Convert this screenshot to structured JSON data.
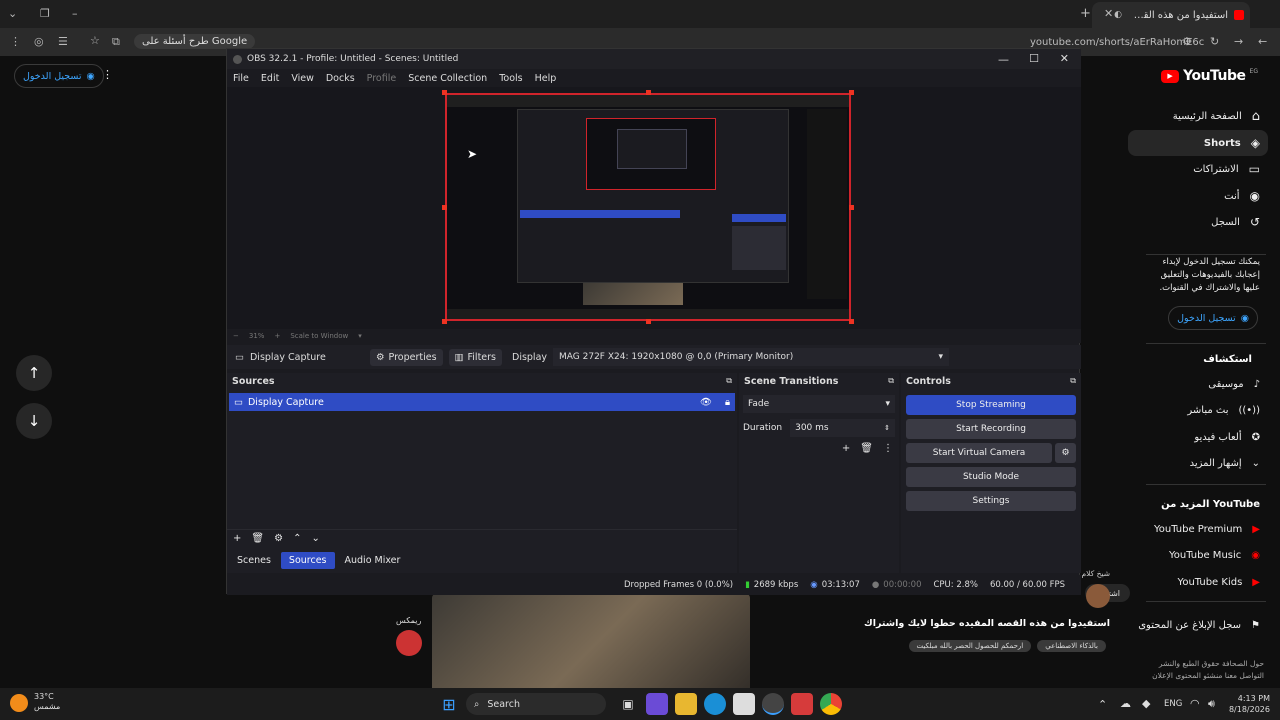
{
  "browser": {
    "tab_title": "استفيدوا من هذه القصه المفيده حطوا لايك",
    "url": "youtube.com/shorts/aErRaHomE6c",
    "search_chip": "طرح أسئلة على Google"
  },
  "youtube": {
    "logo": "YouTube",
    "logo_suffix": "EG",
    "signin": "تسجيل الدخول",
    "nav": [
      {
        "label": "الصفحة الرئيسية",
        "icon": "home-icon"
      },
      {
        "label": "Shorts",
        "icon": "shorts-icon"
      },
      {
        "label": "الاشتراكات",
        "icon": "subscriptions-icon"
      },
      {
        "label": "أنت",
        "icon": "you-icon"
      },
      {
        "label": "السجل",
        "icon": "history-icon"
      }
    ],
    "signin_prompt": "يمكنك تسجيل الدخول لإبداء إعجابك بالفيديوهات والتعليق عليها والاشتراك في القنوات.",
    "explore_title": "استكشاف",
    "explore": [
      {
        "label": "موسيقى",
        "icon": "music-icon"
      },
      {
        "label": "بث مباشر",
        "icon": "live-icon"
      },
      {
        "label": "ألعاب فيديو",
        "icon": "gaming-icon"
      },
      {
        "label": "إشهار المزيد",
        "icon": "more-icon"
      }
    ],
    "more_title": "المزيد من YouTube",
    "more": [
      {
        "label": "YouTube Premium"
      },
      {
        "label": "YouTube Music"
      },
      {
        "label": "YouTube Kids"
      }
    ],
    "report": "سجل الإبلاغ عن المحتوى",
    "footer": "حول الصحافة حقوق الطبع والنشر التواصل معنا منشئو المحتوى الإعلان",
    "short_title": "استفيدوا من هذه القصه المفيده حطوا لايك واشتراك",
    "short_channel": "شيخ كلام",
    "short_subscribe": "اشتراك",
    "short_tag1": "بالذكاء الاصطناعي",
    "short_tag2": "ارحمكم للحصول الحصر بالله مبلكيت",
    "left_user": "ريمكس"
  },
  "obs": {
    "title": "OBS 32.2.1 - Profile: Untitled - Scenes: Untitled",
    "menu": [
      "File",
      "Edit",
      "View",
      "Docks",
      "Profile",
      "Scene Collection",
      "Tools",
      "Help"
    ],
    "zoom": "31%",
    "scale_mode": "Scale to Window",
    "source_name": "Display Capture",
    "properties": "Properties",
    "filters": "Filters",
    "display_label": "Display",
    "display_value": "MAG 272F X24: 1920x1080 @ 0,0 (Primary Monitor)",
    "sources_title": "Sources",
    "sources": [
      "Display Capture"
    ],
    "transitions_title": "Scene Transitions",
    "transition": "Fade",
    "duration_label": "Duration",
    "duration_value": "300 ms",
    "controls_title": "Controls",
    "controls": [
      "Stop Streaming",
      "Start Recording",
      "Start Virtual Camera",
      "Studio Mode",
      "Settings"
    ],
    "tabs": [
      "Scenes",
      "Sources",
      "Audio Mixer"
    ],
    "active_tab": "Sources",
    "status": {
      "dropped": "Dropped Frames 0 (0.0%)",
      "bitrate": "2689 kbps",
      "stream_time": "03:13:07",
      "rec_time": "00:00:00",
      "cpu": "CPU: 2.8%",
      "fps": "60.00 / 60.00 FPS"
    }
  },
  "taskbar": {
    "weather_temp": "33°C",
    "weather_desc": "مشمس",
    "search": "Search",
    "lang": "ENG",
    "time": "4:13 PM",
    "date": "8/18/2026"
  },
  "colors": {
    "obs_accent": "#2f4cc4",
    "preview_border": "#d0242b",
    "youtube_red": "#ff0000"
  }
}
